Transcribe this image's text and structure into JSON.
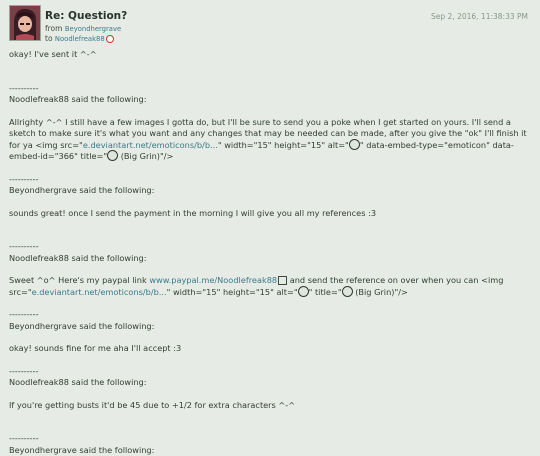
{
  "header": {
    "subject": "Re: Question?",
    "from_label": "from",
    "from_user": "Beyondhergrave",
    "to_label": "to",
    "to_user": "Noodlefreak88",
    "date": "Sep 2, 2016, 11:38:33 PM"
  },
  "messages": {
    "m1": "okay! I've sent it ^-^",
    "sep": "----------",
    "nf_said": "Noodlefreak88 said the following:",
    "bg_said": "Beyondhergrave said the following:",
    "m2_a": "Allrighty ^-^ I still have a few images I gotta do, but I'll be sure to send you a poke when I get started on yours. I'll send a sketch to make sure it's what you want and any changes that may be needed can be made, after you give the \"ok\" I'll finish it for ya <img src=\"",
    "m2_link": "e.deviantart.net/emoticons/b/b...",
    "m2_b": "\" width=\"15\" height=\"15\" alt=\"",
    "m2_c": "\" data-embed-type=\"emoticon\" data-embed-id=\"366\" title=\"",
    "m2_d": " (Big Grin)\"/>",
    "m3": "sounds great! once I send the payment in the morning I will give you all my references :3",
    "m4_a": "Sweet ^o^ Here's my paypal link ",
    "m4_link": "www.paypal.me/Noodlefreak88",
    "m4_b": " and send the reference on over when you can <img src=\"",
    "m4_link2": "e.deviantart.net/emoticons/b/b...",
    "m4_c": "\" width=\"15\" height=\"15\" alt=\"",
    "m4_d": "\" title=\"",
    "m4_e": " (Big Grin)\"/>",
    "m5": "okay! sounds fine for me aha I'll accept :3",
    "m6": "If you're getting busts it'd be 45 due to +1/2 for extra characters ^-^"
  }
}
